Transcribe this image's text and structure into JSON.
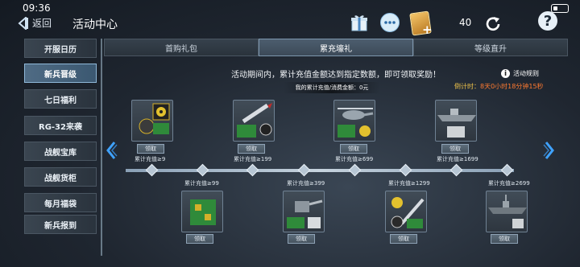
{
  "status_bar": {
    "time": "09:36"
  },
  "header": {
    "back_label": "返回",
    "title": "活动中心",
    "card_count": "40"
  },
  "sidebar": {
    "items": [
      {
        "label": "开服日历",
        "active": false
      },
      {
        "label": "新兵晋级",
        "active": true
      },
      {
        "label": "七日福利",
        "active": false
      },
      {
        "label": "RG-32来袭",
        "active": false
      },
      {
        "label": "战舰宝库",
        "active": false
      },
      {
        "label": "战舰货柜",
        "active": false
      },
      {
        "label": "每月福袋",
        "active": false
      },
      {
        "label": "新兵报到",
        "active": false
      }
    ]
  },
  "tabs": [
    {
      "label": "首购礼包",
      "active": false
    },
    {
      "label": "累充壕礼",
      "active": true
    },
    {
      "label": "等级直升",
      "active": false
    }
  ],
  "notice": "活动期间内，累计充值金额达到指定数额，即可领取奖励！",
  "summary": "我的累计充值/消费金额：0元",
  "rules_label": "活动规则",
  "countdown": {
    "label": "倒计时：",
    "value": "8天0小时18分钟15秒"
  },
  "claim_label": "领取",
  "rewards_top": [
    {
      "threshold": "累计充值≥9",
      "icon": "nuclear-kit-icon"
    },
    {
      "threshold": "累计充值≥199",
      "icon": "missile-icon"
    },
    {
      "threshold": "累计充值≥699",
      "icon": "helicopter-icon"
    },
    {
      "threshold": "累计充值≥1699",
      "icon": "battleship-icon"
    }
  ],
  "rewards_bottom": [
    {
      "threshold": "累计充值≥99",
      "icon": "circuit-board-icon"
    },
    {
      "threshold": "累计充值≥399",
      "icon": "turret-icon"
    },
    {
      "threshold": "累计充值≥1299",
      "icon": "missile-pack-icon"
    },
    {
      "threshold": "累计充值≥2699",
      "icon": "destroyer-icon"
    }
  ],
  "colors": {
    "countdown_label": "#f0c44a",
    "countdown_value": "#ff7a30",
    "active_tab": "#4c5d6e",
    "accent_arrow": "#3fa2ff"
  }
}
